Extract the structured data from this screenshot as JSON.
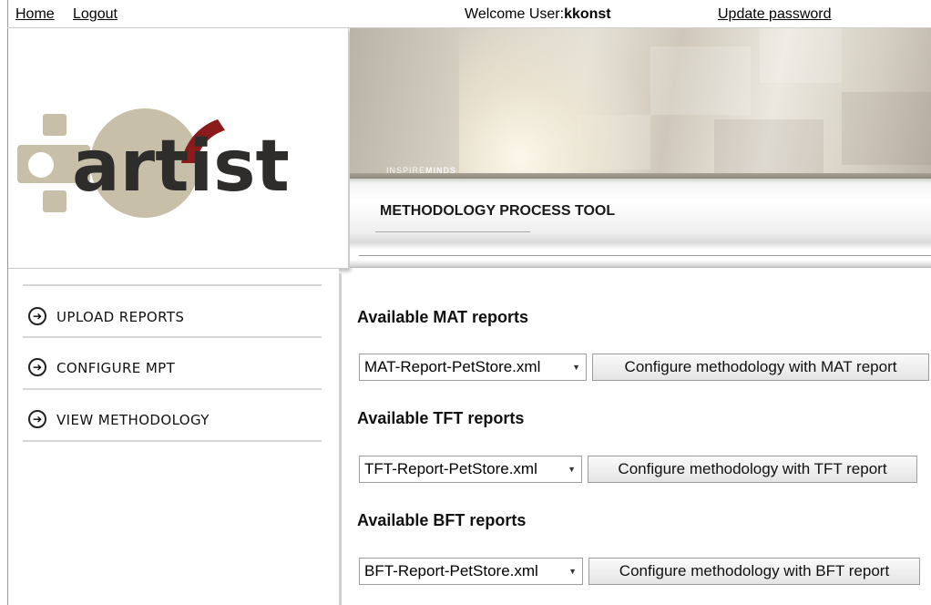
{
  "topbar": {
    "home": "Home",
    "logout": "Logout",
    "welcome_prefix": "Welcome User:",
    "username": "kkonst",
    "update_password": "Update password"
  },
  "header": {
    "logo_text": "artist",
    "banner_tag_left": "INSPIRE",
    "banner_tag_right": "MINDS",
    "title": "METHODOLOGY PROCESS TOOL"
  },
  "sidebar": {
    "items": [
      {
        "label": "UPLOAD REPORTS",
        "icon": "arrow-circle-right-icon"
      },
      {
        "label": "CONFIGURE MPT",
        "icon": "arrow-circle-right-icon"
      },
      {
        "label": "VIEW METHODOLOGY",
        "icon": "arrow-circle-right-icon"
      }
    ]
  },
  "reports": [
    {
      "title": "Available MAT reports",
      "selected": "MAT-Report-PetStore.xml",
      "button": "Configure methodology with MAT report"
    },
    {
      "title": "Available TFT reports",
      "selected": "TFT-Report-PetStore.xml",
      "button": "Configure methodology with TFT report"
    },
    {
      "title": "Available BFT reports",
      "selected": "BFT-Report-PetStore.xml",
      "button": "Configure methodology with BFT report"
    }
  ],
  "colors": {
    "logo_text": "#2f2d2b",
    "logo_gear": "#c8bfa8",
    "logo_accent": "#8b1a1a"
  }
}
